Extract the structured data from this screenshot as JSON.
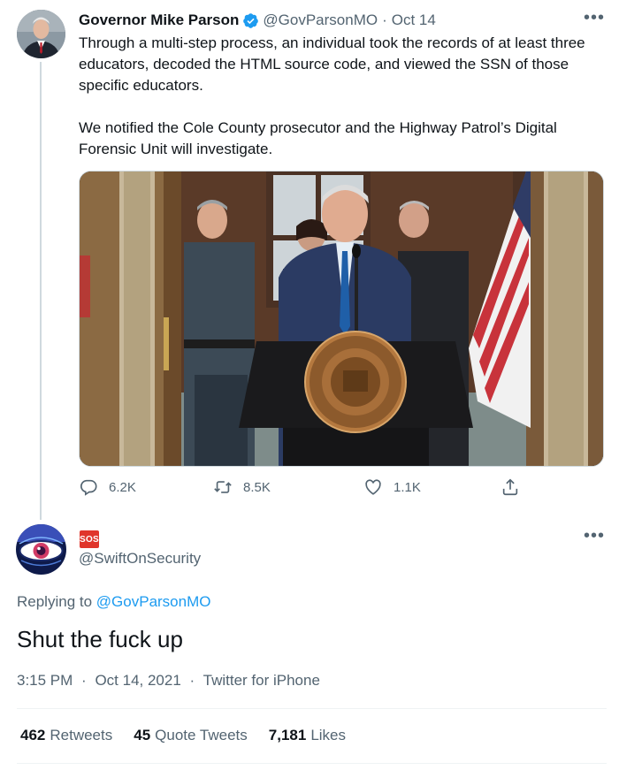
{
  "tweet1": {
    "author_name": "Governor Mike Parson",
    "verified": true,
    "handle": "@GovParsonMO",
    "separator": "·",
    "date": "Oct 14",
    "text_p1": "Through a multi-step process, an individual took the records of at least three educators, decoded the HTML source code, and viewed the SSN of those specific educators.",
    "text_p2": "We notified the Cole County prosecutor and the Highway Patrol’s Digital Forensic Unit will investigate.",
    "reply_count": "6.2K",
    "retweet_count": "8.5K",
    "like_count": "1.1K",
    "icons": {
      "reply": "reply-icon",
      "retweet": "retweet-icon",
      "like": "heart-icon",
      "share": "share-icon",
      "more": "more-icon",
      "verified": "verified-badge-icon"
    }
  },
  "tweet2": {
    "badge_text": "SOS",
    "handle": "@SwiftOnSecurity",
    "replying_prefix": "Replying to",
    "replying_to": "@GovParsonMO",
    "text": "Shut the fuck up",
    "time": "3:15 PM",
    "separator": "·",
    "date": "Oct 14, 2021",
    "source": "Twitter for iPhone",
    "retweets_count": "462",
    "retweets_label": "Retweets",
    "quote_count": "45",
    "quote_label": "Quote Tweets",
    "likes_count": "7,181",
    "likes_label": "Likes"
  },
  "colors": {
    "text_primary": "#0f1419",
    "text_secondary": "#536471",
    "link": "#1d9bf0",
    "verified": "#1d9bf0",
    "sos_badge": "#e0352b",
    "divider": "#eff3f4",
    "thread_line": "#cfd9de"
  }
}
